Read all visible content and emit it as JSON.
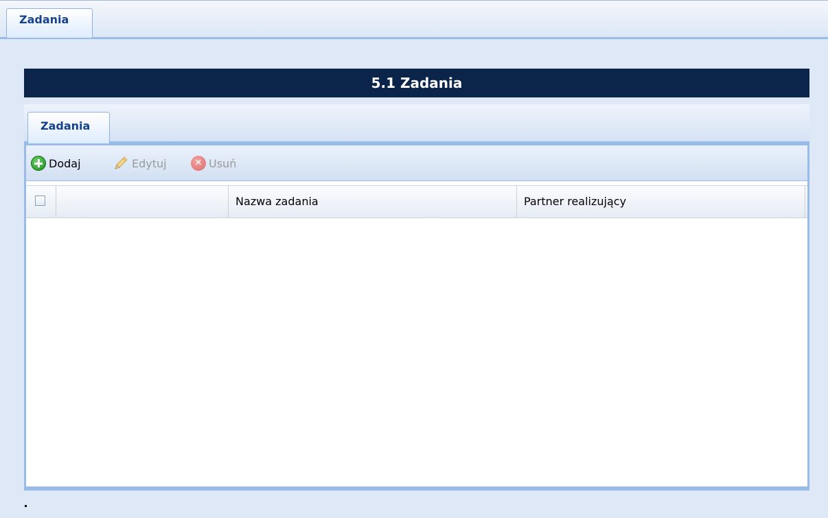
{
  "top_tab": {
    "label": "Zadania"
  },
  "title": "5.1 Zadania",
  "inner_tab": {
    "label": "Zadania"
  },
  "toolbar": {
    "add_label": "Dodaj",
    "edit_label": "Edytuj",
    "delete_label": "Usuń",
    "add_icon": "add-circle-icon",
    "edit_icon": "pencil-icon",
    "delete_icon": "delete-circle-icon"
  },
  "grid": {
    "columns": [
      "",
      "Nazwa zadania",
      "Partner realizujący"
    ],
    "rows": []
  },
  "footer_text": ".",
  "colors": {
    "title_bg": "#0b2449",
    "tab_text": "#15428b",
    "border": "#99bbe8",
    "add_icon": "#1c8a1c"
  }
}
